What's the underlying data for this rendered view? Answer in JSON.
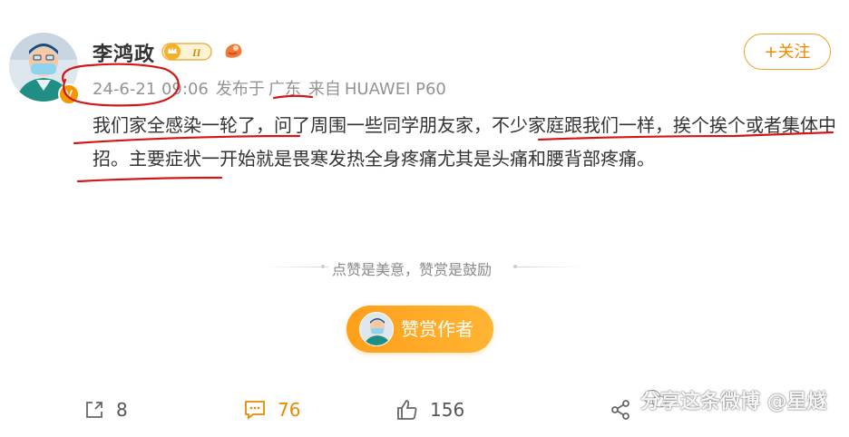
{
  "post": {
    "author": {
      "name": "李鸿政",
      "level_badge": "II",
      "verified_badge": "V"
    },
    "meta": {
      "time": "24-6-21 09:06",
      "location_prefix": "发布于",
      "location": "广东",
      "source_prefix": "来自",
      "device": "HUAWEI P60"
    },
    "follow_label": "+关注",
    "text": "我们家全感染一轮了，问了周围一些同学朋友家，不少家庭跟我们一样，挨个挨个或者集体中招。主要症状一开始就是畏寒发热全身疼痛尤其是头痛和腰背部疼痛。"
  },
  "reward": {
    "caption": "点赞是美意，赞赏是鼓励",
    "button_label": "赞赏作者"
  },
  "actions": {
    "share_count": "8",
    "comment_count": "76",
    "like_count": "156"
  },
  "watermark": {
    "text": "分享这条微博 @星燧"
  },
  "colors": {
    "accent": "#ef8a00",
    "reward_gradient_start": "#ff9f1a",
    "annotation_red": "#d01818"
  }
}
